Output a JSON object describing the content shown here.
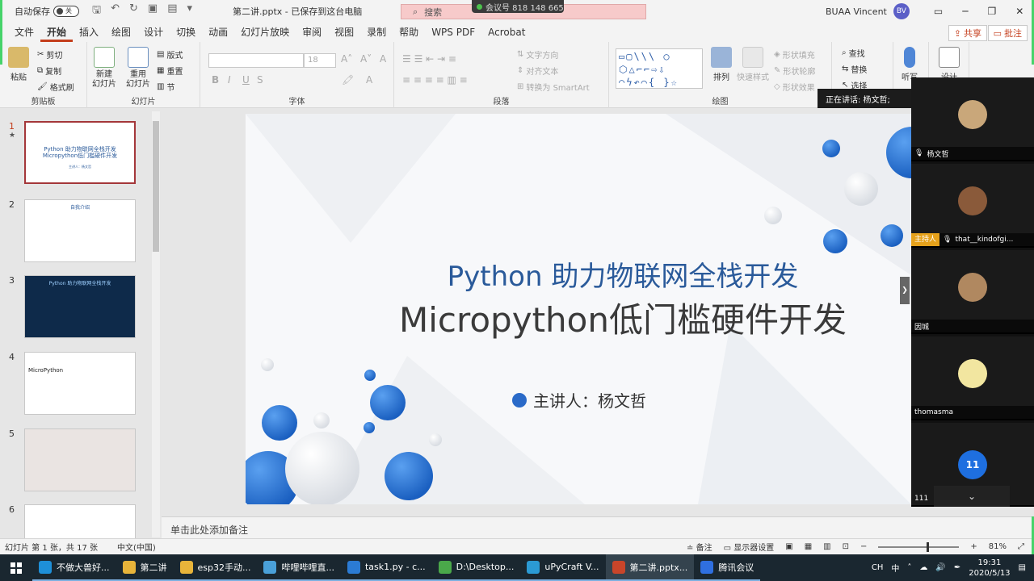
{
  "titlebar": {
    "autosave_label": "自动保存",
    "toggle_state": "关",
    "doc_title": "第二讲.pptx  -  已保存到这台电脑",
    "search_placeholder": "搜索",
    "meeting_id": "会议号 818 148 665",
    "user_name": "BUAA Vincent",
    "user_initials": "BV"
  },
  "ribbon_tabs": [
    "文件",
    "开始",
    "插入",
    "绘图",
    "设计",
    "切换",
    "动画",
    "幻灯片放映",
    "审阅",
    "视图",
    "录制",
    "帮助",
    "WPS PDF",
    "Acrobat"
  ],
  "ribbon_active_tab": "开始",
  "share_label": "共享",
  "comment_label": "批注",
  "ribbon": {
    "clipboard": {
      "paste": "粘贴",
      "cut": "剪切",
      "copy": "复制",
      "format_painter": "格式刷",
      "group": "剪贴板"
    },
    "slides": {
      "new_slide": "新建\n幻灯片",
      "reuse": "重用\n幻灯片",
      "layout": "版式",
      "reset": "重置",
      "section": "节",
      "group": "幻灯片"
    },
    "font": {
      "size": "18",
      "bold": "B",
      "italic": "I",
      "underline": "U",
      "strike": "S",
      "group": "字体"
    },
    "paragraph": {
      "text_direction": "文字方向",
      "align_text": "对齐文本",
      "smartart": "转换为 SmartArt",
      "group": "段落"
    },
    "drawing": {
      "arrange": "排列",
      "quick_styles": "快速样式",
      "shape_fill": "形状填充",
      "shape_outline": "形状轮廓",
      "shape_effects": "形状效果",
      "group": "绘图"
    },
    "editing": {
      "find": "查找",
      "replace": "替换",
      "select": "选择"
    },
    "voice": {
      "dictate": "听写"
    },
    "designer": {
      "label": "设计"
    }
  },
  "thumbnails": [
    {
      "num": "1",
      "active": true,
      "line1": "Python 助力物联网全栈开发",
      "line2": "Micropython低门槛硬件开发",
      "line3": "主讲人：杨文哲"
    },
    {
      "num": "2",
      "active": false,
      "line1": "自我介绍",
      "line2": "",
      "line3": ""
    },
    {
      "num": "3",
      "active": false,
      "line1": "Python 助力物联网全栈开发",
      "line2": "",
      "line3": ""
    },
    {
      "num": "4",
      "active": false,
      "line1": "MicroPython",
      "line2": "",
      "line3": ""
    },
    {
      "num": "5",
      "active": false,
      "line1": "",
      "line2": "",
      "line3": ""
    },
    {
      "num": "6",
      "active": false,
      "line1": "",
      "line2": "",
      "line3": ""
    }
  ],
  "slide": {
    "title_line1": "Python 助力物联网全栈开发",
    "title_line2": "Micropython低门槛硬件开发",
    "speaker": "主讲人：杨文哲"
  },
  "notes_placeholder": "单击此处添加备注",
  "statusbar": {
    "slide_info": "幻灯片 第 1 张，共 17 张",
    "language": "中文(中国)",
    "notes": "备注",
    "display_settings": "显示器设置",
    "zoom": "81%"
  },
  "meeting": {
    "speaking_tip": "正在讲话: 杨文哲;",
    "participants": [
      {
        "name": "杨文哲",
        "host": false,
        "color": "#c9a77a"
      },
      {
        "name": "that__kindofgi...",
        "host": true,
        "host_label": "主持人",
        "color": "#8a5a3a"
      },
      {
        "name": "因城",
        "host": false,
        "color": "#b08860"
      },
      {
        "name": "thomasma",
        "host": false,
        "color": "#f2e6a0"
      }
    ],
    "more_count": "11",
    "more_label": "111"
  },
  "taskbar": {
    "items": [
      {
        "label": "不做大兽好...",
        "color": "#1e8fd8",
        "active": false
      },
      {
        "label": "第二讲",
        "color": "#e8b43a",
        "active": false
      },
      {
        "label": "esp32手动...",
        "color": "#e8b43a",
        "active": false
      },
      {
        "label": "哔哩哔哩直...",
        "color": "#4aa0d8",
        "active": false
      },
      {
        "label": "task1.py - c...",
        "color": "#2b7bd4",
        "active": false
      },
      {
        "label": "D:\\Desktop...",
        "color": "#4aa84a",
        "active": false
      },
      {
        "label": "uPyCraft V...",
        "color": "#2b9ad4",
        "active": false
      },
      {
        "label": "第二讲.pptx...",
        "color": "#c8452a",
        "active": true
      },
      {
        "label": "腾讯会议",
        "color": "#2f6fe0",
        "active": false
      }
    ],
    "ime": "CH",
    "ime2": "中",
    "time": "19:31",
    "date": "2020/5/13"
  }
}
